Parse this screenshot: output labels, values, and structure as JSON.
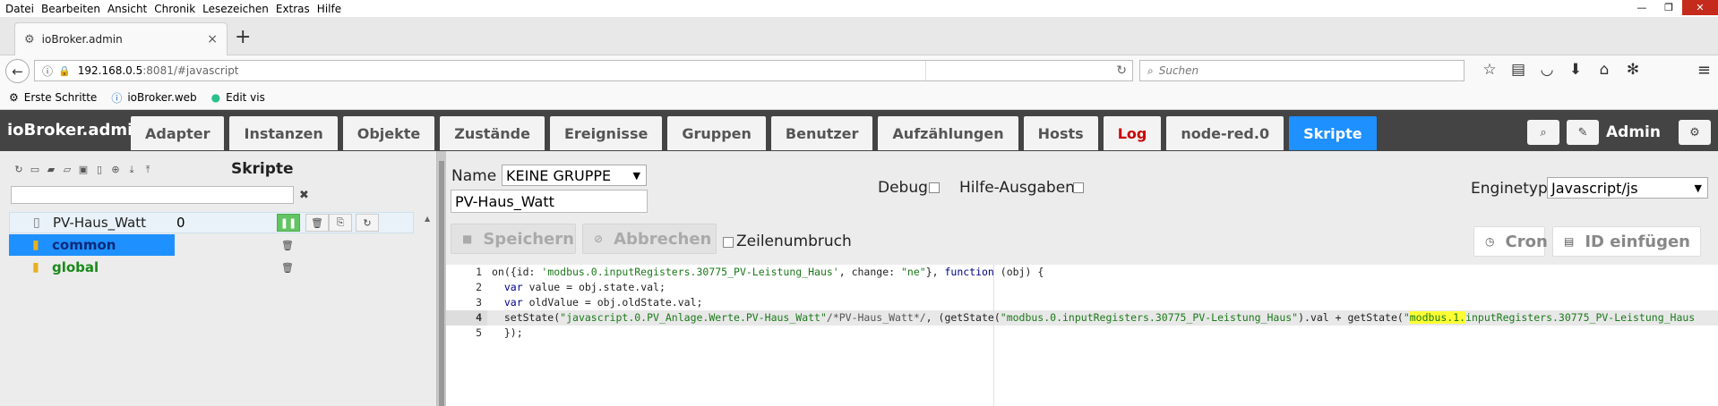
{
  "menu": [
    "Datei",
    "Bearbeiten",
    "Ansicht",
    "Chronik",
    "Lesezeichen",
    "Extras",
    "Hilfe"
  ],
  "window_controls": {
    "minimize": "—",
    "maximize": "❐",
    "close": "✕"
  },
  "browser_tab": {
    "title": "ioBroker.admin",
    "close": "×",
    "new_tab": "+"
  },
  "url": {
    "host": "192.168.0.5",
    "rest": ":8081/#javascript"
  },
  "search": {
    "placeholder": "Suchen"
  },
  "bookmarks": [
    {
      "label": "Erste Schritte"
    },
    {
      "label": "ioBroker.web"
    },
    {
      "label": "Edit vis"
    }
  ],
  "app": {
    "title": "ioBroker.admin",
    "tabs": [
      "Adapter",
      "Instanzen",
      "Objekte",
      "Zustände",
      "Ereignisse",
      "Gruppen",
      "Benutzer",
      "Aufzählungen",
      "Hosts",
      "Log",
      "node-red.0",
      "Skripte"
    ],
    "active_tab": "Skripte",
    "user": "Admin"
  },
  "left_panel": {
    "title": "Skripte",
    "clear": "✖",
    "rows": [
      {
        "name": "PV-Haus_Watt",
        "value": "0"
      },
      {
        "name": "common"
      },
      {
        "name": "global"
      }
    ]
  },
  "editor_panel": {
    "name_label": "Name",
    "group_value": "KEINE GRUPPE",
    "script_name": "PV-Haus_Watt",
    "debug_label": "Debug",
    "help_label": "Hilfe-Ausgaben",
    "engine_label": "Enginetyp",
    "engine_value": "Javascript/js",
    "save_label": "Speichern",
    "cancel_label": "Abbrechen",
    "wrap_label": "Zeilenumbruch",
    "cron_label": "Cron",
    "insert_id_label": "ID einfügen"
  },
  "code": {
    "line_numbers": [
      "1",
      "2",
      "3",
      "4",
      "5"
    ],
    "l1a": "on({id: ",
    "l1b": "'modbus.0.inputRegisters.30775_PV-Leistung_Haus'",
    "l1c": ", change: ",
    "l1d": "\"ne\"",
    "l1e": "}, ",
    "l1f": "function",
    "l1g": " (obj) {",
    "l2a": "  ",
    "l2b": "var",
    "l2c": " value = obj.state.val;",
    "l3a": "  ",
    "l3b": "var",
    "l3c": " oldValue = obj.oldState.val;",
    "l4a": "  setState(",
    "l4b": "\"javascript.0.PV_Anlage.Werte.PV-Haus_Watt\"",
    "l4c": "/*PV-Haus_Watt*/",
    "l4d": ", (getState(",
    "l4e": "\"modbus.0.inputRegisters.30775_PV-Leistung_Haus\"",
    "l4f": ").val + getState(",
    "l4g": "\"",
    "l4h": "modbus.1.",
    "l4i": "inputRegisters.30775_PV-Leistung_Haus",
    "l5": "  });"
  }
}
